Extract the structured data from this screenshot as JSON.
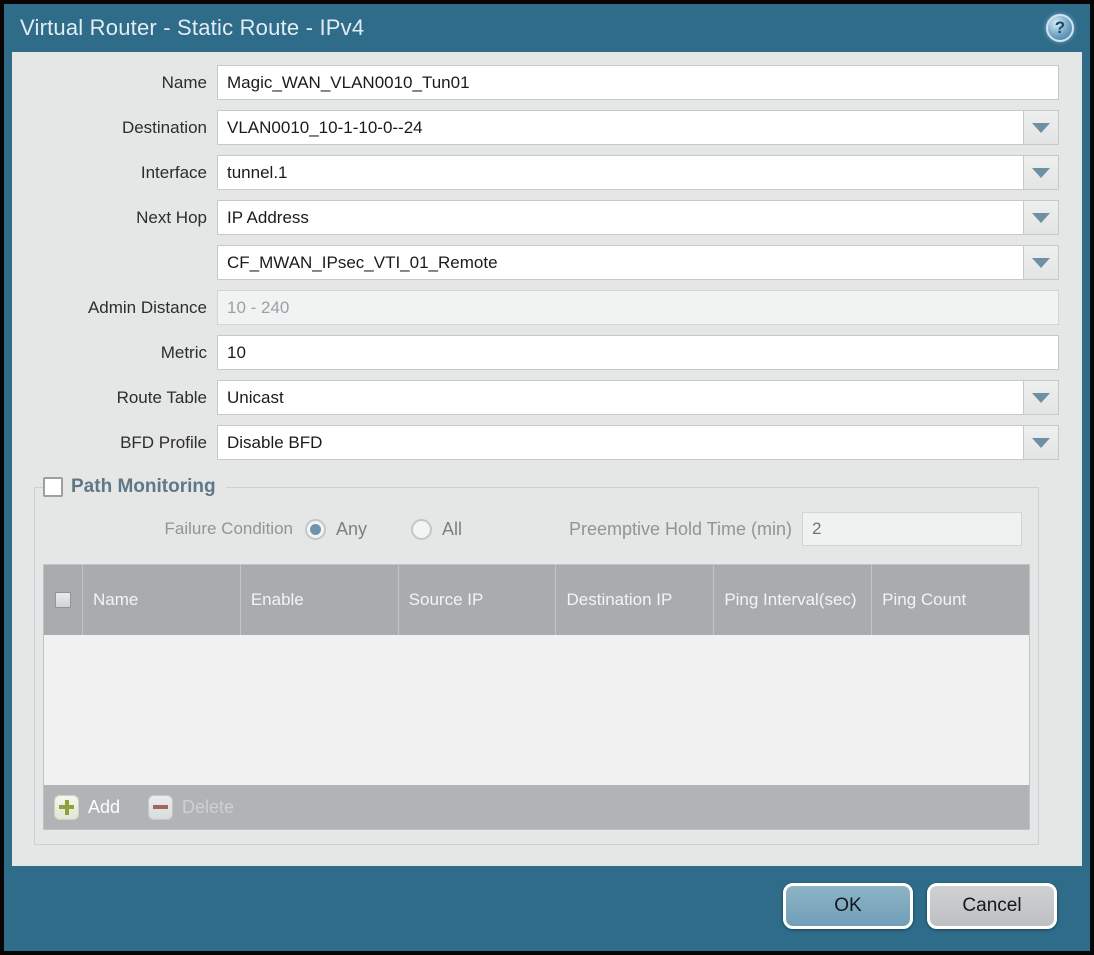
{
  "titlebar": {
    "title": "Virtual Router - Static Route - IPv4",
    "help_glyph": "?"
  },
  "form": {
    "fields": [
      {
        "label": "Name",
        "value": "Magic_WAN_VLAN0010_Tun01",
        "type": "text"
      },
      {
        "label": "Destination",
        "value": "VLAN0010_10-1-10-0--24",
        "type": "dropdown"
      },
      {
        "label": "Interface",
        "value": "tunnel.1",
        "type": "dropdown"
      },
      {
        "label": "Next Hop",
        "value": "IP Address",
        "type": "dropdown"
      },
      {
        "label": "",
        "value": "CF_MWAN_IPsec_VTI_01_Remote",
        "type": "dropdown"
      },
      {
        "label": "Admin Distance",
        "value": "",
        "placeholder": "10 - 240",
        "type": "text"
      },
      {
        "label": "Metric",
        "value": "10",
        "type": "text"
      },
      {
        "label": "Route Table",
        "value": "Unicast",
        "type": "dropdown"
      },
      {
        "label": "BFD Profile",
        "value": "Disable BFD",
        "type": "dropdown"
      }
    ]
  },
  "path_monitoring": {
    "title": "Path Monitoring",
    "enabled": false,
    "failure_condition": {
      "label": "Failure Condition",
      "options": [
        {
          "label": "Any",
          "selected": true
        },
        {
          "label": "All",
          "selected": false
        }
      ]
    },
    "preemptive_hold_time": {
      "label": "Preemptive Hold Time (min)",
      "value": "2"
    },
    "table": {
      "columns": [
        "Name",
        "Enable",
        "Source IP",
        "Destination IP",
        "Ping Interval(sec)",
        "Ping Count"
      ],
      "rows": []
    },
    "toolbar": {
      "add_label": "Add",
      "delete_label": "Delete"
    }
  },
  "footer": {
    "ok_label": "OK",
    "cancel_label": "Cancel"
  },
  "colors": {
    "chrome_teal": "#2f6c8a",
    "content_bg": "#e5e6e6",
    "table_header_bg": "#a9acae",
    "radio_selected": "#6f94a9",
    "ok_button": "#7fa9c0",
    "cancel_button": "#c6c8ca",
    "add_plus": "#8ca33b",
    "delete_minus": "#a3655c"
  }
}
